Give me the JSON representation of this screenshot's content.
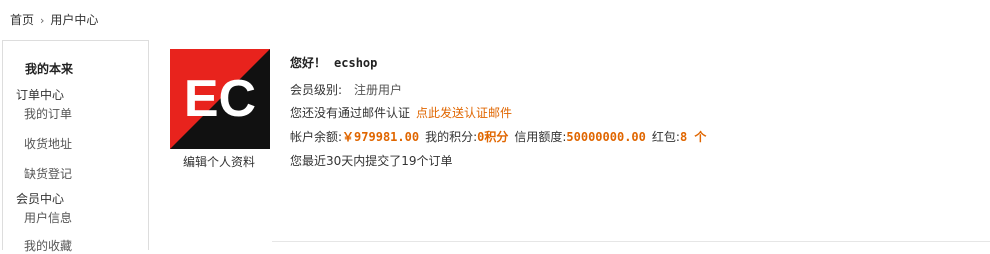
{
  "breadcrumb": {
    "home": "首页",
    "separator": "›",
    "current": "用户中心"
  },
  "sidebar": {
    "title": "我的本来",
    "group_order": "订单中心",
    "link_my_orders": "我的订单",
    "link_address": "收货地址",
    "link_shortage": "缺货登记",
    "group_member": "会员中心",
    "link_user_info": "用户信息",
    "link_partial": "我的收藏"
  },
  "avatar": {
    "text": "EC",
    "colors": {
      "red": "#e8231d",
      "black": "#111111",
      "letters": "#ffffff"
    }
  },
  "edit_profile": "编辑个人资料",
  "info": {
    "hello": "您好！",
    "username": "ecshop",
    "level_label": "会员级别:",
    "level_value": "注册用户",
    "email_notice": "您还没有通过邮件认证",
    "email_link": "点此发送认证邮件",
    "balance_label": "帐户余额:",
    "balance_value": "￥979981.00",
    "points_label": "我的积分:",
    "points_value": "0积分",
    "credit_label": "信用额度:",
    "credit_value": "50000000.00",
    "bonus_label": "红包:",
    "bonus_value": "8 个",
    "recent_orders": "您最近30天内提交了19个订单"
  },
  "accent_color": "#e06600"
}
